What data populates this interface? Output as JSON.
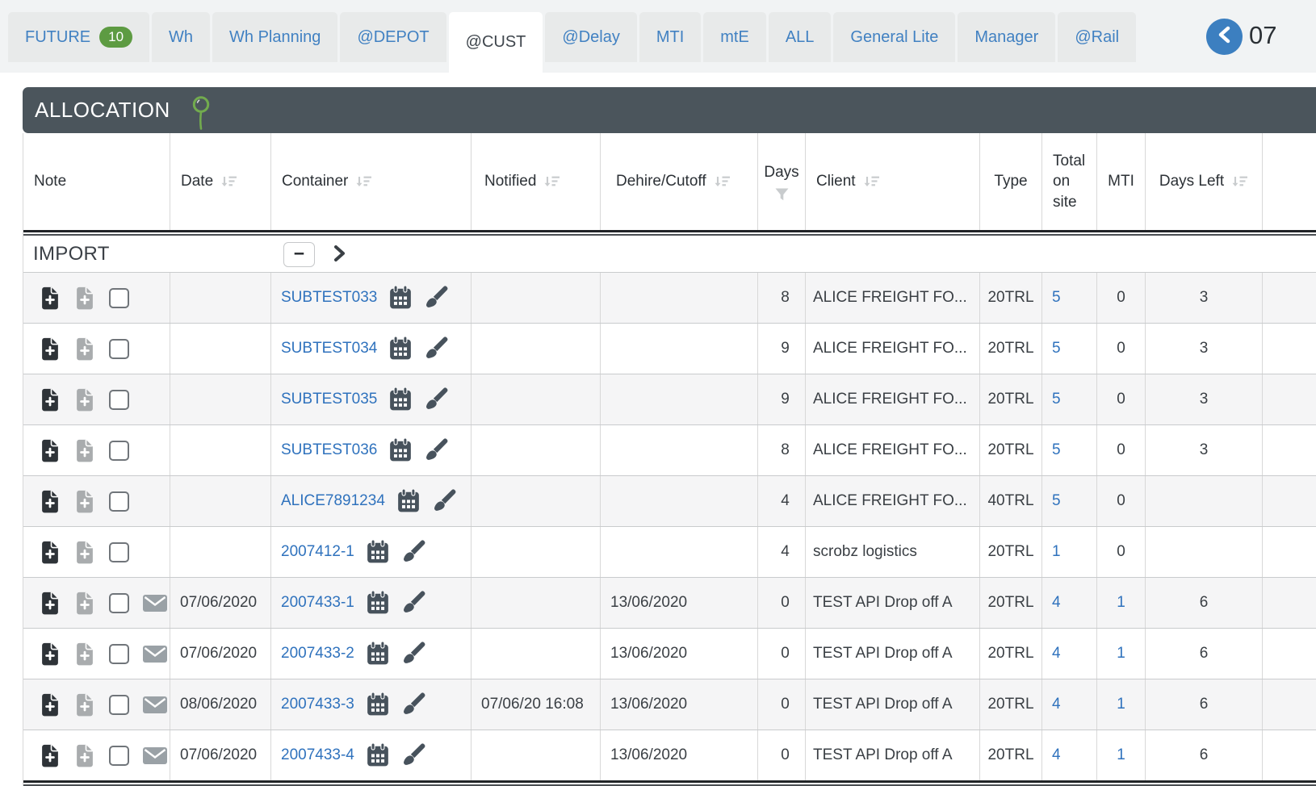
{
  "tabs": {
    "items": [
      {
        "label": "FUTURE",
        "badge": "10",
        "active": false
      },
      {
        "label": "Wh",
        "active": false
      },
      {
        "label": "Wh Planning",
        "active": false
      },
      {
        "label": "@DEPOT",
        "active": false
      },
      {
        "label": "@CUST",
        "active": true
      },
      {
        "label": "@Delay",
        "active": false
      },
      {
        "label": "MTI",
        "active": false
      },
      {
        "label": "mtE",
        "active": false
      },
      {
        "label": "ALL",
        "active": false
      },
      {
        "label": "General Lite",
        "active": false
      },
      {
        "label": "Manager",
        "active": false
      },
      {
        "label": "@Rail",
        "active": false
      }
    ],
    "nav_value": "07"
  },
  "section": {
    "title": "ALLOCATION"
  },
  "group": {
    "label": "IMPORT",
    "collapse_label": "−"
  },
  "table": {
    "columns": [
      {
        "key": "note",
        "label": "Note",
        "sortable": false,
        "filter": false,
        "align": "left"
      },
      {
        "key": "date",
        "label": "Date",
        "sortable": true,
        "filter": false,
        "align": "left"
      },
      {
        "key": "container",
        "label": "Container",
        "sortable": true,
        "filter": false,
        "align": "left"
      },
      {
        "key": "notified",
        "label": "Notified",
        "sortable": true,
        "filter": false,
        "align": "left"
      },
      {
        "key": "dehire",
        "label": "Dehire/Cutoff",
        "sortable": true,
        "filter": false,
        "align": "left"
      },
      {
        "key": "days",
        "label": "Days",
        "sortable": false,
        "filter": true,
        "align": "center"
      },
      {
        "key": "client",
        "label": "Client",
        "sortable": true,
        "filter": false,
        "align": "left"
      },
      {
        "key": "type",
        "label": "Type",
        "sortable": false,
        "filter": false,
        "align": "center"
      },
      {
        "key": "total",
        "label": "Total on site",
        "sortable": false,
        "filter": false,
        "align": "left"
      },
      {
        "key": "mti",
        "label": "MTI",
        "sortable": false,
        "filter": false,
        "align": "center"
      },
      {
        "key": "days_left",
        "label": "Days Left",
        "sortable": true,
        "filter": false,
        "align": "center"
      },
      {
        "key": "stub",
        "label": "",
        "sortable": false,
        "filter": false,
        "align": "left"
      }
    ],
    "rows": [
      {
        "container": "SUBTEST033",
        "date": "",
        "notified": "",
        "dehire": "",
        "days": "8",
        "client": "ALICE FREIGHT FO...",
        "type": "20TRL",
        "total": "5",
        "mti": "0",
        "mti_link": false,
        "days_left": "3",
        "mail": false
      },
      {
        "container": "SUBTEST034",
        "date": "",
        "notified": "",
        "dehire": "",
        "days": "9",
        "client": "ALICE FREIGHT FO...",
        "type": "20TRL",
        "total": "5",
        "mti": "0",
        "mti_link": false,
        "days_left": "3",
        "mail": false
      },
      {
        "container": "SUBTEST035",
        "date": "",
        "notified": "",
        "dehire": "",
        "days": "9",
        "client": "ALICE FREIGHT FO...",
        "type": "20TRL",
        "total": "5",
        "mti": "0",
        "mti_link": false,
        "days_left": "3",
        "mail": false
      },
      {
        "container": "SUBTEST036",
        "date": "",
        "notified": "",
        "dehire": "",
        "days": "8",
        "client": "ALICE FREIGHT FO...",
        "type": "20TRL",
        "total": "5",
        "mti": "0",
        "mti_link": false,
        "days_left": "3",
        "mail": false
      },
      {
        "container": "ALICE7891234",
        "date": "",
        "notified": "",
        "dehire": "",
        "days": "4",
        "client": "ALICE FREIGHT FO...",
        "type": "40TRL",
        "total": "5",
        "mti": "0",
        "mti_link": false,
        "days_left": "",
        "mail": false
      },
      {
        "container": "2007412-1",
        "date": "",
        "notified": "",
        "dehire": "",
        "days": "4",
        "client": "scrobz logistics",
        "type": "20TRL",
        "total": "1",
        "mti": "0",
        "mti_link": false,
        "days_left": "",
        "mail": false
      },
      {
        "container": "2007433-1",
        "date": "07/06/2020",
        "notified": "",
        "dehire": "13/06/2020",
        "days": "0",
        "client": "TEST API Drop off A",
        "type": "20TRL",
        "total": "4",
        "mti": "1",
        "mti_link": true,
        "days_left": "6",
        "mail": true
      },
      {
        "container": "2007433-2",
        "date": "07/06/2020",
        "notified": "",
        "dehire": "13/06/2020",
        "days": "0",
        "client": "TEST API Drop off A",
        "type": "20TRL",
        "total": "4",
        "mti": "1",
        "mti_link": true,
        "days_left": "6",
        "mail": true
      },
      {
        "container": "2007433-3",
        "date": "08/06/2020",
        "notified": "07/06/20 16:08",
        "dehire": "13/06/2020",
        "days": "0",
        "client": "TEST API Drop off A",
        "type": "20TRL",
        "total": "4",
        "mti": "1",
        "mti_link": true,
        "days_left": "6",
        "mail": true
      },
      {
        "container": "2007433-4",
        "date": "07/06/2020",
        "notified": "",
        "dehire": "13/06/2020",
        "days": "0",
        "client": "TEST API Drop off A",
        "type": "20TRL",
        "total": "4",
        "mti": "1",
        "mti_link": true,
        "days_left": "6",
        "mail": true
      }
    ]
  },
  "colors": {
    "tab_text": "#4181c2",
    "tab_bg": "#e8eaea",
    "active_tab_text": "#3f464d",
    "badge_green": "#5d9b42",
    "nav_circle_blue": "#3c7fc0",
    "section_bar_bg": "#4b555c",
    "pin_green": "#72ab4e",
    "link_blue": "#2f72bd",
    "icon_slate": "#47525c",
    "icon_dark": "#2e3338",
    "icon_gray": "#a9acae",
    "mail_gray": "#9aa1a6",
    "sort_gray": "#c9ccce",
    "row_alt_bg": "#f5f5f6",
    "border_light": "#d8d8d8",
    "text_dark": "#3a3f44"
  }
}
